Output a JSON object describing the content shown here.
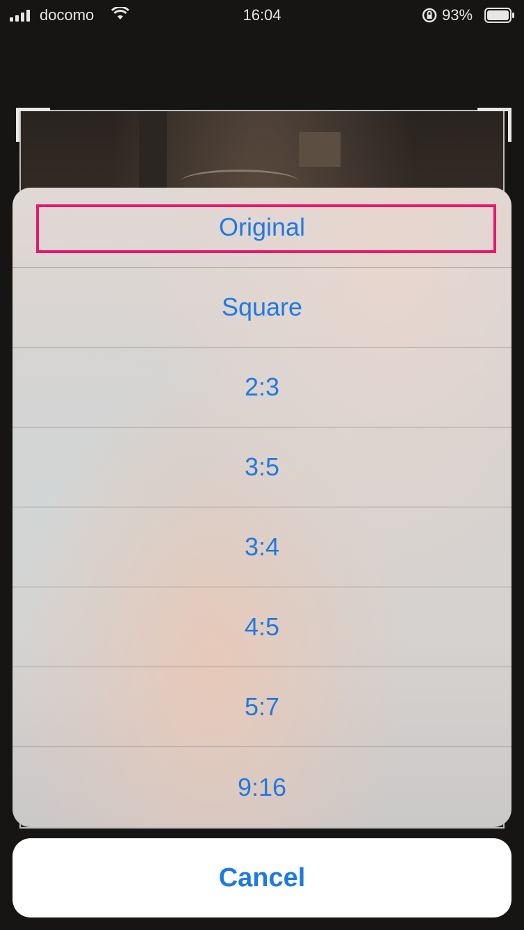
{
  "status_bar": {
    "carrier": "docomo",
    "time": "16:04",
    "battery_percent": "93%"
  },
  "action_sheet": {
    "items": [
      {
        "label": "Original",
        "highlighted": true
      },
      {
        "label": "Square"
      },
      {
        "label": "2:3"
      },
      {
        "label": "3:5"
      },
      {
        "label": "3:4"
      },
      {
        "label": "4:5"
      },
      {
        "label": "5:7"
      },
      {
        "label": "9:16"
      }
    ],
    "cancel_label": "Cancel"
  },
  "colors": {
    "accent": "#1f7ae0",
    "highlight_outline": "#e8186d"
  },
  "icons": [
    "signal-icon",
    "wifi-icon",
    "rotation-lock-icon",
    "battery-icon"
  ]
}
